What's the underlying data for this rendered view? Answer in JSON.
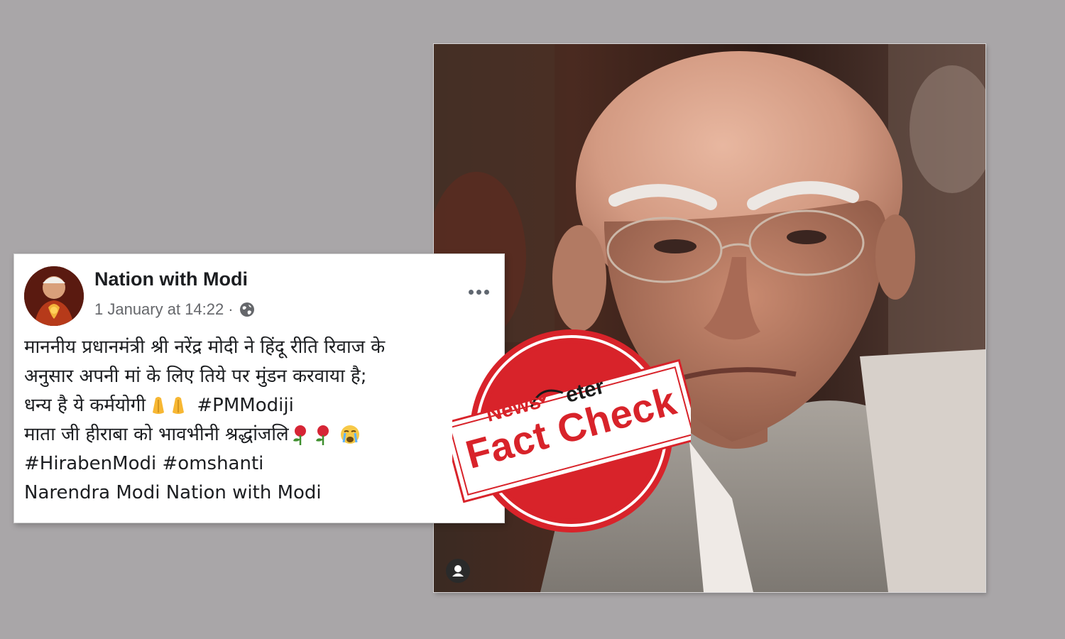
{
  "post": {
    "author": "Nation with Modi",
    "timestamp": "1 January at 14:22",
    "separator": "·",
    "lines": {
      "l1": "माननीय प्रधानमंत्री श्री नरेंद्र मोदी ने हिंदू रीति रिवाज के",
      "l2": "अनुसार अपनी मां के लिए तिये पर मुंडन करवाया है;",
      "l3_text": "धन्य है ये कर्मयोगी",
      "l3_hashtag": "#PMModiji",
      "l4": "माता जी हीराबा को भावभीनी श्रद्धांजलि",
      "l5_hashtag1": "#HirabenModi",
      "l5_hashtag2": "#omshanti",
      "l6_mention1": "Narendra Modi",
      "l6_mention2": "Nation with Modi"
    },
    "icons": {
      "privacy": "globe-icon",
      "more": "more-options-icon",
      "emoji_l3": [
        "folded-hands-emoji",
        "folded-hands-emoji"
      ],
      "emoji_l4": [
        "rose-emoji",
        "rose-emoji",
        "crying-face-emoji"
      ]
    }
  },
  "stamp": {
    "brand_news": "News",
    "brand_meter": "eter",
    "label": "Fact Check"
  },
  "photo": {
    "icon": "user-tag-icon"
  },
  "colors": {
    "background": "#a9a6a8",
    "stamp_red": "#d8232a",
    "meta_gray": "#65676b"
  }
}
